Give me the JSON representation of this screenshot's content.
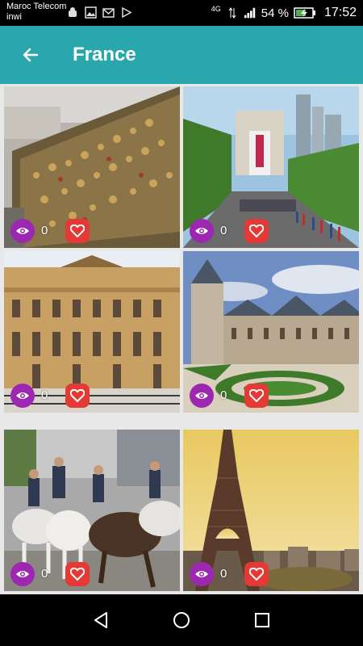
{
  "status_bar": {
    "carrier_line1": "Maroc Telecom",
    "carrier_line2": "inwi",
    "network": "4G",
    "battery_percent": "54 %",
    "time": "17:52"
  },
  "app_bar": {
    "title": "France",
    "back_icon": "arrow-left-icon"
  },
  "cards": [
    {
      "id": "locks-bridge",
      "views": "0"
    },
    {
      "id": "arc-de-triomphe",
      "views": "0"
    },
    {
      "id": "palace-versailles",
      "views": "0"
    },
    {
      "id": "chateau-garden",
      "views": "0"
    },
    {
      "id": "camargue-horses",
      "views": "0"
    },
    {
      "id": "eiffel-tower",
      "views": "0"
    }
  ],
  "colors": {
    "app_bar": "#2aa7ad",
    "eye_button": "#9c27b0",
    "heart_button": "#e53935"
  },
  "nav_bar": {
    "icons": [
      "back-triangle-icon",
      "home-circle-icon",
      "recents-square-icon"
    ]
  }
}
